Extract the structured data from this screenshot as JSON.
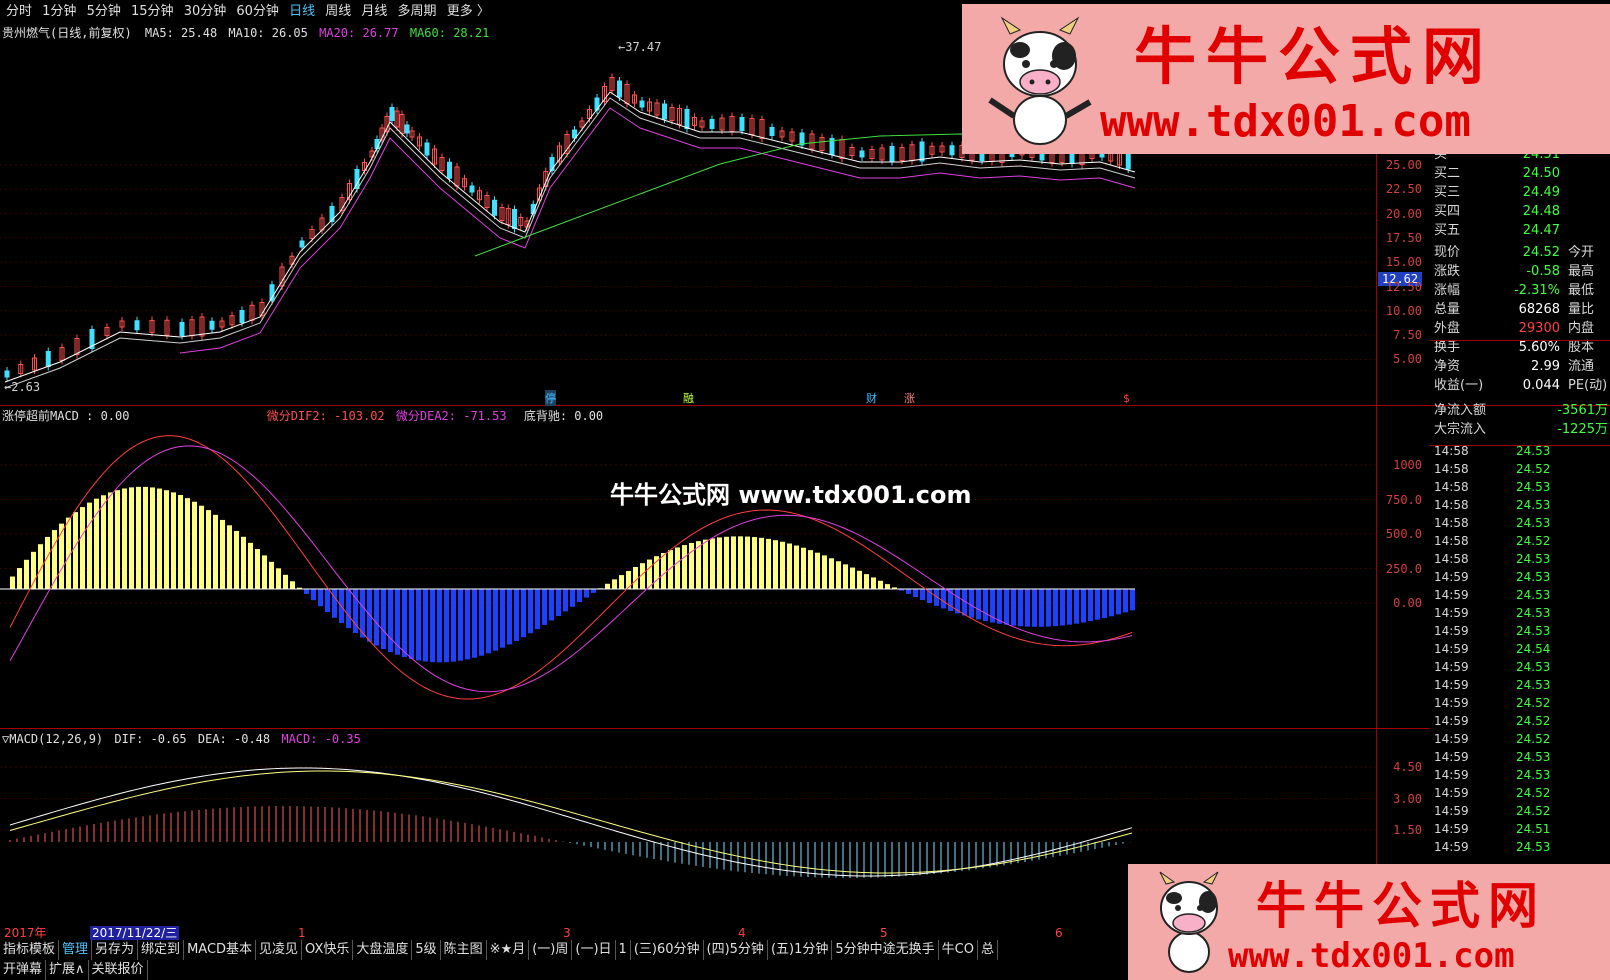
{
  "topbar": {
    "items": [
      "分时",
      "1分钟",
      "5分钟",
      "15分钟",
      "30分钟",
      "60分钟",
      "日线",
      "周线",
      "月线",
      "多周期",
      "更多 〉"
    ],
    "active_index": 6
  },
  "main_chart": {
    "title": "贵州燃气(日线,前复权)",
    "indicators": [
      {
        "label": "MA5: 25.48",
        "color": "#ffffff"
      },
      {
        "label": "MA10: 26.05",
        "color": "#ffffff"
      },
      {
        "label": "MA20: 26.77",
        "color": "#e040e0"
      },
      {
        "label": "MA60: 28.21",
        "color": "#40e040"
      }
    ],
    "high_label": "37.47",
    "low_label": "2.63",
    "current_price_tag": "12.62",
    "y_ticks": [
      "25.00",
      "22.50",
      "20.00",
      "17.50",
      "15.00",
      "12.50",
      "10.00",
      "7.50",
      "5.00"
    ],
    "markers": [
      {
        "text": "停",
        "color": "#40c0ff"
      },
      {
        "text": "融",
        "color": "#c0ff40"
      },
      {
        "text": "财",
        "color": "#40c0ff"
      },
      {
        "text": "涨",
        "color": "#ff8080"
      },
      {
        "text": "$",
        "color": "#ff4040"
      }
    ]
  },
  "panel2": {
    "title": "涨停超前MACD : 0.00",
    "dif_label": "微分DIF2: -103.02",
    "dea_label": "微分DEA2: -71.53",
    "divergence_label": "底背驰: 0.00",
    "watermark": "牛牛公式网 www.tdx001.com",
    "y_ticks": [
      "1000",
      "750.0",
      "500.0",
      "250.0",
      "0.00"
    ]
  },
  "panel3": {
    "title": "MACD(12,26,9)",
    "dif_label": "DIF: -0.65",
    "dea_label": "DEA: -0.48",
    "macd_label": "MACD: -0.35",
    "y_ticks": [
      "4.50",
      "3.00",
      "1.50"
    ]
  },
  "timeline": {
    "year": "2017年",
    "date": "2017/11/22/三",
    "months": [
      "1",
      "3",
      "4",
      "5",
      "6"
    ]
  },
  "quotes": {
    "buys": [
      {
        "label": "买一",
        "value": "24.51"
      },
      {
        "label": "买二",
        "value": "24.50"
      },
      {
        "label": "买三",
        "value": "24.49"
      },
      {
        "label": "买四",
        "value": "24.48"
      },
      {
        "label": "买五",
        "value": "24.47"
      }
    ],
    "stats": [
      {
        "label": "现价",
        "value": "24.52",
        "value_color": "#40ff40",
        "right": "今开"
      },
      {
        "label": "涨跌",
        "value": "-0.58",
        "value_color": "#40ff40",
        "right": "最高"
      },
      {
        "label": "涨幅",
        "value": "-2.31%",
        "value_color": "#40ff40",
        "right": "最低"
      },
      {
        "label": "总量",
        "value": "68268",
        "value_color": "#ffffff",
        "right": "量比"
      },
      {
        "label": "外盘",
        "value": "29300",
        "value_color": "#ff4040",
        "right": "内盘"
      },
      {
        "label": "换手",
        "value": "5.60%",
        "value_color": "#ffffff",
        "right": "股本"
      },
      {
        "label": "净资",
        "value": "2.99",
        "value_color": "#ffffff",
        "right": "流通"
      },
      {
        "label": "收益(一)",
        "value": "0.044",
        "value_color": "#ffffff",
        "right": "PE(动)"
      }
    ],
    "flows": [
      {
        "label": "净流入额",
        "value": "-3561万"
      },
      {
        "label": "大宗流入",
        "value": "-1225万"
      }
    ],
    "ticks": [
      {
        "time": "14:58",
        "price": "24.53"
      },
      {
        "time": "14:58",
        "price": "24.52"
      },
      {
        "time": "14:58",
        "price": "24.53"
      },
      {
        "time": "14:58",
        "price": "24.53"
      },
      {
        "time": "14:58",
        "price": "24.53"
      },
      {
        "time": "14:58",
        "price": "24.52"
      },
      {
        "time": "14:58",
        "price": "24.53"
      },
      {
        "time": "14:59",
        "price": "24.53"
      },
      {
        "time": "14:59",
        "price": "24.53"
      },
      {
        "time": "14:59",
        "price": "24.53"
      },
      {
        "time": "14:59",
        "price": "24.53"
      },
      {
        "time": "14:59",
        "price": "24.54"
      },
      {
        "time": "14:59",
        "price": "24.53"
      },
      {
        "time": "14:59",
        "price": "24.53"
      },
      {
        "time": "14:59",
        "price": "24.52"
      },
      {
        "time": "14:59",
        "price": "24.52"
      },
      {
        "time": "14:59",
        "price": "24.52"
      },
      {
        "time": "14:59",
        "price": "24.53"
      },
      {
        "time": "14:59",
        "price": "24.53"
      },
      {
        "time": "14:59",
        "price": "24.52"
      },
      {
        "time": "14:59",
        "price": "24.52"
      },
      {
        "time": "14:59",
        "price": "24.51"
      },
      {
        "time": "14:59",
        "price": "24.53"
      }
    ]
  },
  "bottombar": {
    "row1": [
      "指标模板",
      "管理",
      "另存为",
      "绑定到",
      "MACD基本",
      "见凌见",
      "OX快乐",
      "大盘温度",
      "5级",
      "陈主图",
      "※★月",
      "(一)周",
      "(一)日",
      "1",
      "(三)60分钟",
      "(四)5分钟",
      "(五)1分钟",
      "5分钟中途无换手",
      "牛CO",
      "总"
    ],
    "row2": [
      "开弹幕",
      "扩展∧",
      "关联报价"
    ]
  },
  "ads": {
    "title": "牛牛公式网",
    "url": "www.tdx001.com"
  },
  "colors": {
    "up": "#ff5050",
    "down": "#40e0ff",
    "grid": "#a00000"
  }
}
